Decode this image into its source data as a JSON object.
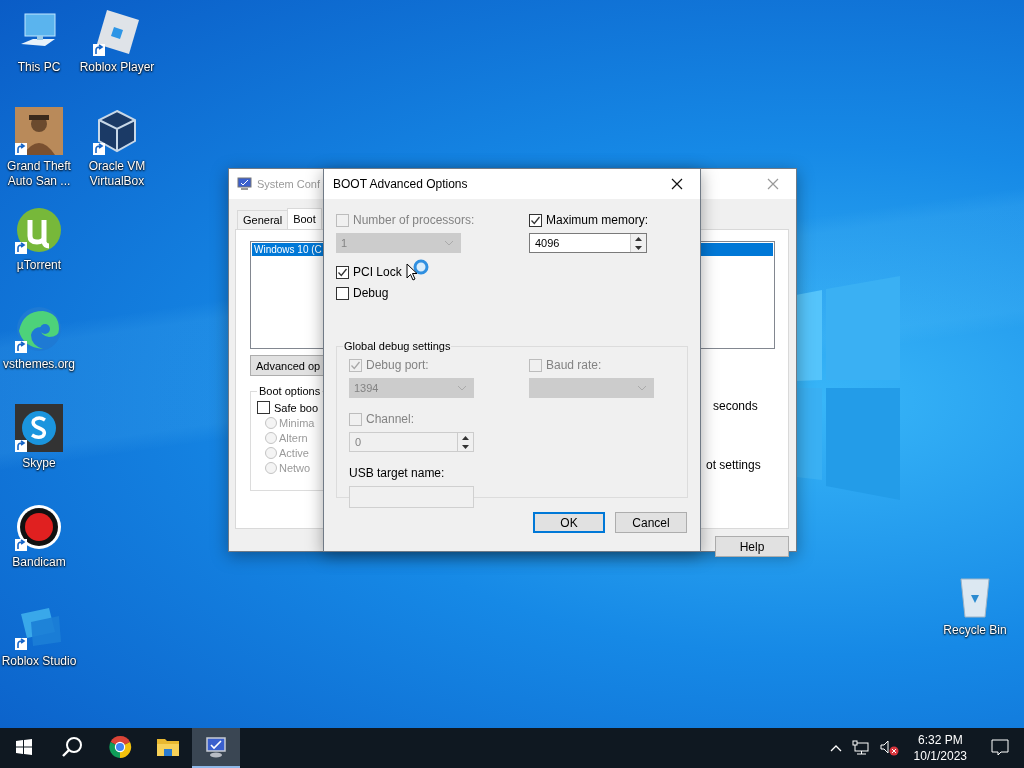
{
  "desktop": {
    "icon_columns": [
      [
        {
          "label": "This PC",
          "kind": "pc",
          "shortcut": false
        },
        {
          "label": "Grand Theft Auto San ...",
          "kind": "game",
          "shortcut": true
        },
        {
          "label": "µTorrent",
          "kind": "torrent",
          "shortcut": true
        },
        {
          "label": "vsthemes.org",
          "kind": "browser",
          "shortcut": true
        },
        {
          "label": "Skype",
          "kind": "chat",
          "shortcut": true
        },
        {
          "label": "Bandicam",
          "kind": "recorder",
          "shortcut": true
        },
        {
          "label": "Roblox Studio",
          "kind": "studio",
          "shortcut": true
        }
      ],
      [
        {
          "label": "Roblox Player",
          "kind": "player",
          "shortcut": true
        },
        {
          "label": "Oracle VM VirtualBox",
          "kind": "cube",
          "shortcut": true
        }
      ]
    ],
    "corner_icons": [
      {
        "label": "Recycle Bin",
        "kind": "bin",
        "shortcut": false
      }
    ]
  },
  "system_configuration": {
    "title": "System Conf",
    "tabs": [
      {
        "label": "General",
        "selected": false
      },
      {
        "label": "Boot",
        "selected": true
      }
    ],
    "os_list": [
      {
        "label": "Windows 10 (C",
        "selected": true
      }
    ],
    "advanced_button": "Advanced op",
    "boot_options": {
      "title": "Boot options",
      "safe_boot": {
        "label": "Safe boo",
        "checked": false
      },
      "modes": [
        {
          "label": "Minima",
          "selected": false,
          "disabled": true
        },
        {
          "label": "Altern",
          "selected": false,
          "disabled": true
        },
        {
          "label": "Active",
          "selected": false,
          "disabled": true
        },
        {
          "label": "Netwo",
          "selected": false,
          "disabled": true
        }
      ]
    },
    "timeout_unit": "seconds",
    "make_permanent": "ot settings",
    "help_button": "Help"
  },
  "boot_advanced_options": {
    "title": "BOOT Advanced Options",
    "number_of_processors": {
      "label": "Number of processors:",
      "checked": false,
      "value": "1",
      "disabled": true
    },
    "maximum_memory": {
      "label": "Maximum memory:",
      "checked": true,
      "value": "4096"
    },
    "pci_lock": {
      "label": "PCI Lock",
      "checked": true
    },
    "debug": {
      "label": "Debug",
      "checked": false
    },
    "global_debug_settings": {
      "title": "Global debug settings",
      "debug_port": {
        "label": "Debug port:",
        "checked": true,
        "disabled": true,
        "value": "1394"
      },
      "baud_rate": {
        "label": "Baud rate:",
        "checked": false,
        "disabled": true
      },
      "channel": {
        "label": "Channel:",
        "checked": false,
        "disabled": true,
        "value": "0"
      },
      "usb_target_name": {
        "label": "USB target name:",
        "disabled": true
      }
    },
    "buttons": [
      {
        "label": "OK",
        "default": true
      },
      {
        "label": "Cancel",
        "default": false
      }
    ]
  },
  "taskbar": {
    "buttons": [
      {
        "kind": "start"
      },
      {
        "kind": "search"
      }
    ],
    "pinned": [
      {
        "kind": "chrome",
        "selected": false
      },
      {
        "kind": "folder",
        "selected": false
      },
      {
        "kind": "msconfig",
        "selected": true
      }
    ],
    "tray": {
      "time": "6:32 PM",
      "date": "10/1/2023",
      "volume_muted": true
    }
  }
}
